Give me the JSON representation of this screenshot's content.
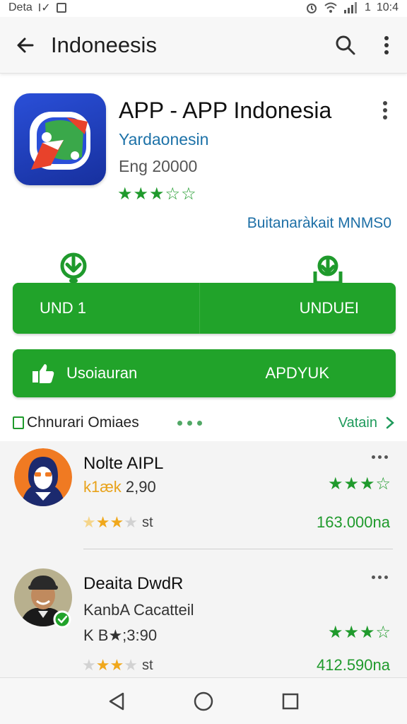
{
  "status_bar": {
    "left_text": "Deta",
    "left_extra": "I✓",
    "time": "10:4",
    "battery_text": "1"
  },
  "app_bar": {
    "title": "Indoneesis",
    "back_icon": "arrow-left-icon",
    "search_icon": "search-icon",
    "menu_icon": "more-vert-icon"
  },
  "app": {
    "title": "APP - APP Indonesia",
    "developer": "Yardaonesin",
    "meta": "Eng 20000",
    "stars": "★★★☆☆",
    "rating_value": 3.5,
    "link": "Buitanaràkait MNMS0",
    "icon_colors": {
      "bg": "#2a4fd8",
      "accent": "#e8422b",
      "green": "#3aa84a"
    }
  },
  "buttons": {
    "download_left": "UND 1",
    "download_right": "UNDUEI",
    "secondary_left": "Usoiauran",
    "secondary_right": "APDYUK"
  },
  "section": {
    "title": "Chnurari Omiaes",
    "link": "Vatain",
    "link_icon": "chevron-right-icon"
  },
  "list": [
    {
      "name": "Nolte AIPL",
      "price_hi": "k1æk",
      "price": "2,90",
      "stars": 3,
      "stars_suffix": "st",
      "rating": "★★★☆",
      "count": "163.000na",
      "avatar": "hijab-woman-avatar"
    },
    {
      "name": "Deaita DwdR",
      "sub": "KanbA Cacatteil",
      "price": "K B★;3:90",
      "stars": 3,
      "stars_suffix": "st",
      "rating": "★★★☆",
      "count": "412.590na",
      "avatar": "man-with-cap-avatar"
    }
  ],
  "nav": {
    "back_icon": "nav-back-icon",
    "home_icon": "nav-home-icon",
    "recents_icon": "nav-recents-icon"
  },
  "colors": {
    "accent": "#21a32a",
    "link": "#1d6fa6",
    "star_green": "#1f9a2c",
    "star_orange": "#f0a81c"
  }
}
